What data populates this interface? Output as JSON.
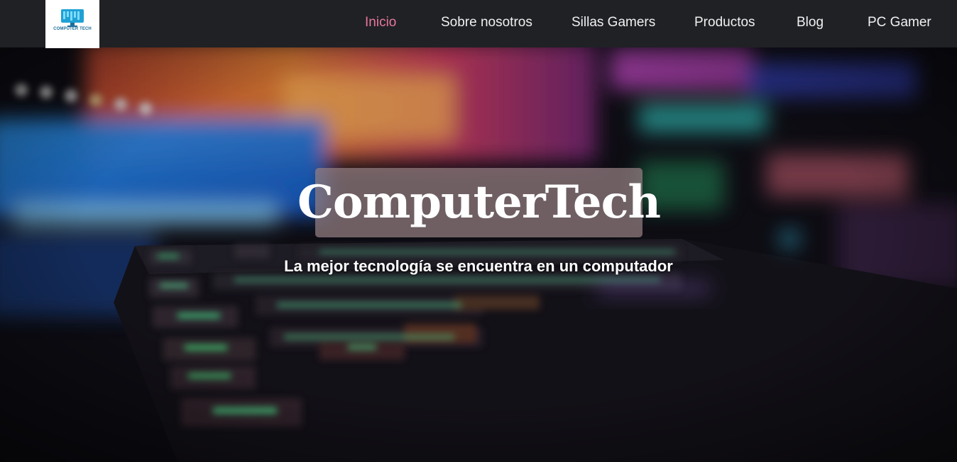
{
  "brand": {
    "logo_text": "COMPUTER TECH"
  },
  "nav": {
    "items": [
      {
        "label": "Inicio",
        "active": true
      },
      {
        "label": "Sobre nosotros",
        "active": false
      },
      {
        "label": "Sillas Gamers",
        "active": false
      },
      {
        "label": "Productos",
        "active": false
      },
      {
        "label": "Blog",
        "active": false
      },
      {
        "label": "PC Gamer",
        "active": false
      }
    ]
  },
  "hero": {
    "title": "ComputerTech",
    "subtitle": "La mejor tecnología se encuentra en un computador",
    "background": "gaming-keyboard-rgb-photo"
  },
  "colors": {
    "navbar_bg": "#202125",
    "active_link": "#e8779c",
    "link": "#f1f1f1",
    "title_box": "#968082",
    "brand_blue": "#1d6e99"
  }
}
